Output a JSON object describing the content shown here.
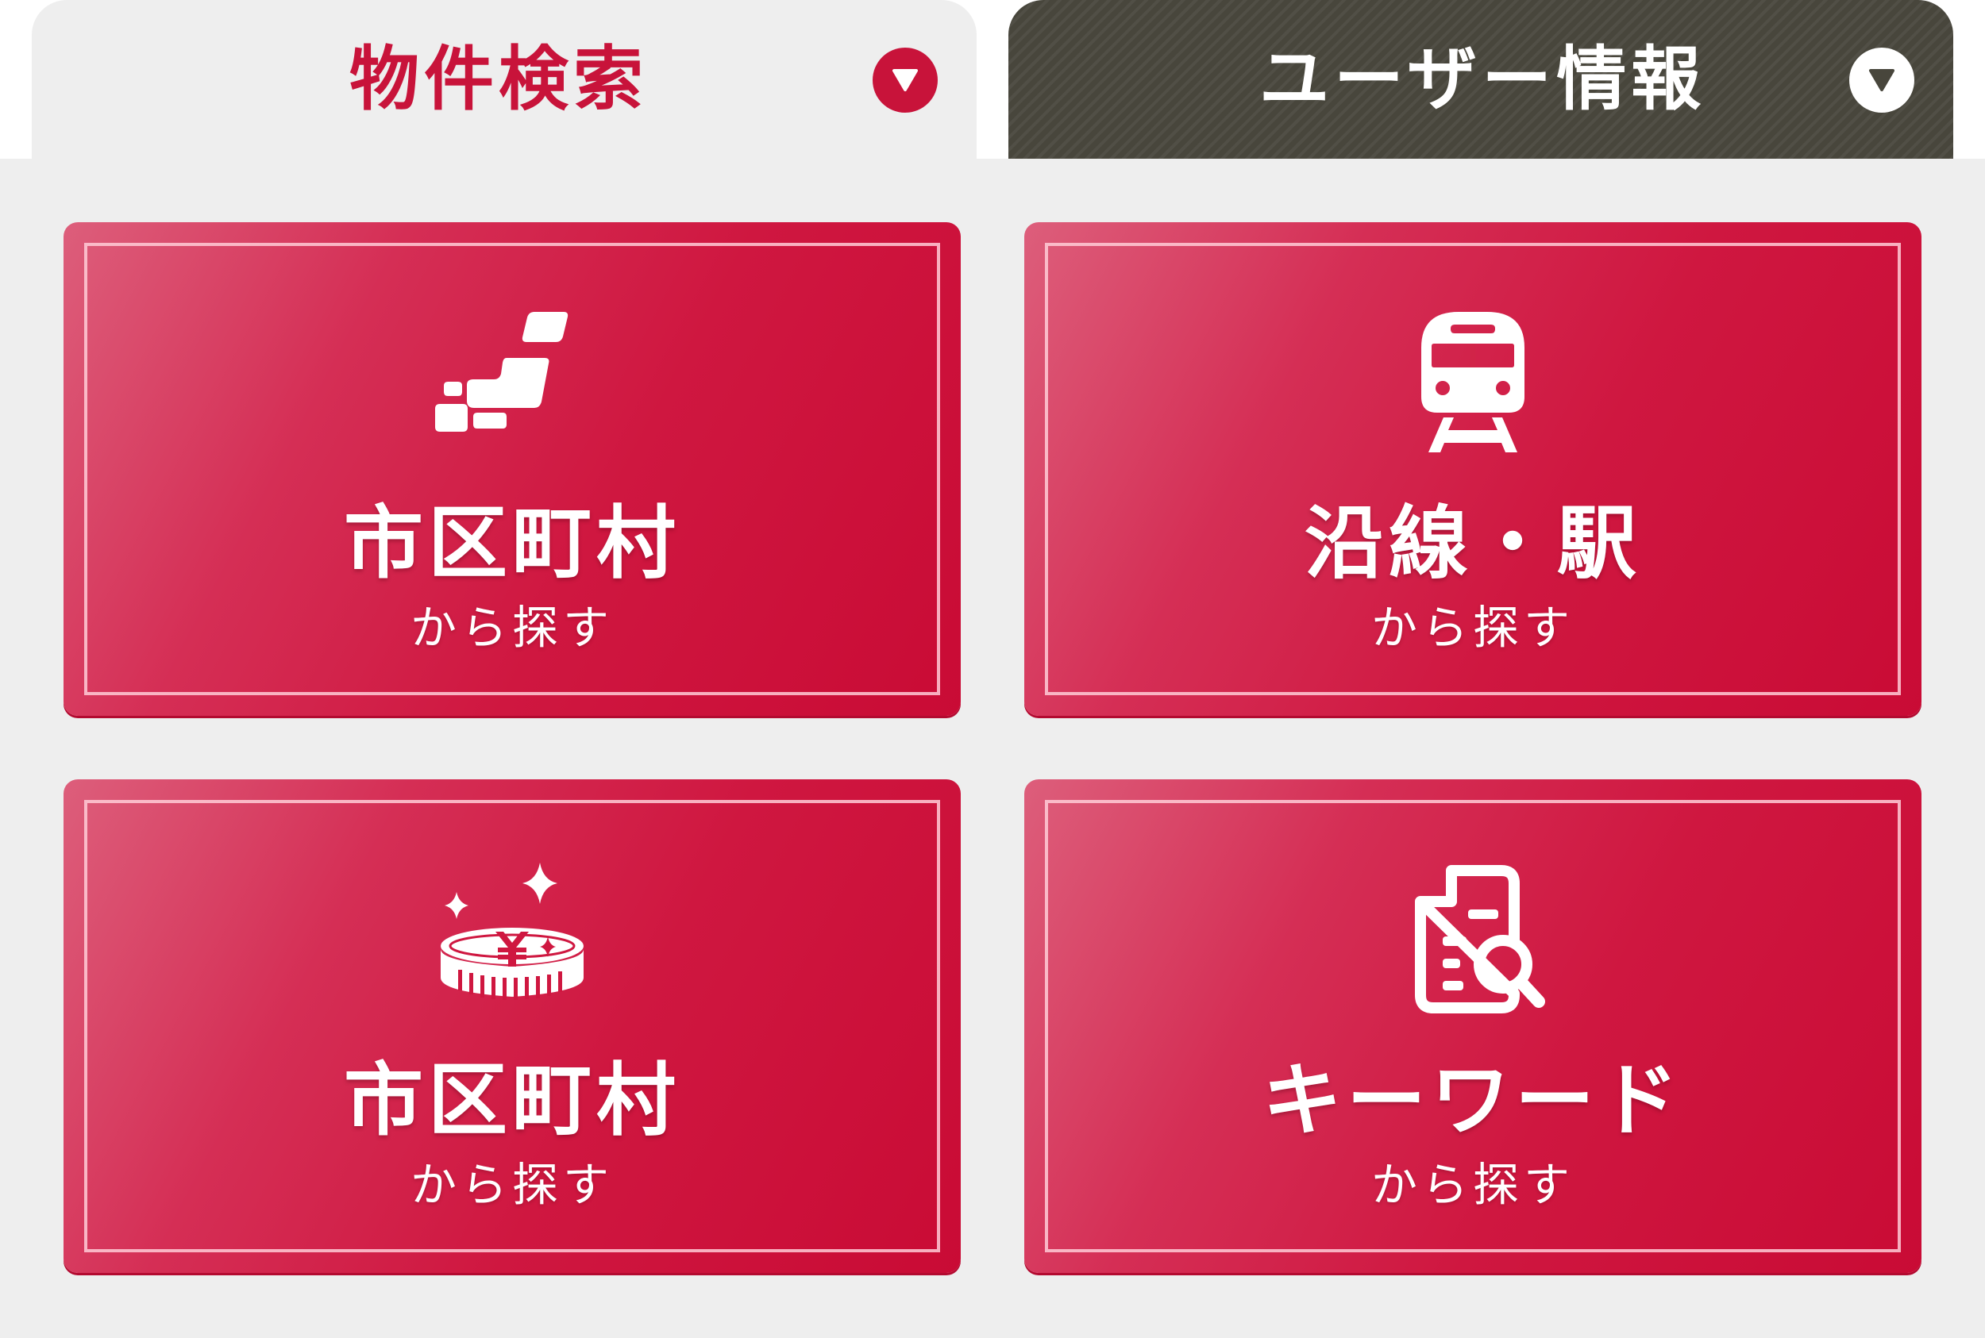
{
  "tabs": {
    "search": {
      "label": "物件検索",
      "state": "active"
    },
    "user": {
      "label": "ユーザー情報",
      "state": "inactive"
    }
  },
  "cards": [
    {
      "title": "市区町村",
      "subtitle": "から探す",
      "icon": "japan-map-icon"
    },
    {
      "title": "沿線・駅",
      "subtitle": "から探す",
      "icon": "train-icon"
    },
    {
      "title": "市区町村",
      "subtitle": "から探す",
      "icon": "yen-coin-icon"
    },
    {
      "title": "キーワード",
      "subtitle": "から探す",
      "icon": "document-search-icon"
    }
  ],
  "colors": {
    "accent": "#c8133a",
    "card_gradient_start": "#dd5e7b",
    "card_gradient_end": "#c90b35",
    "panel_bg": "#eeeeee",
    "user_tab_bg": "#48463c"
  }
}
